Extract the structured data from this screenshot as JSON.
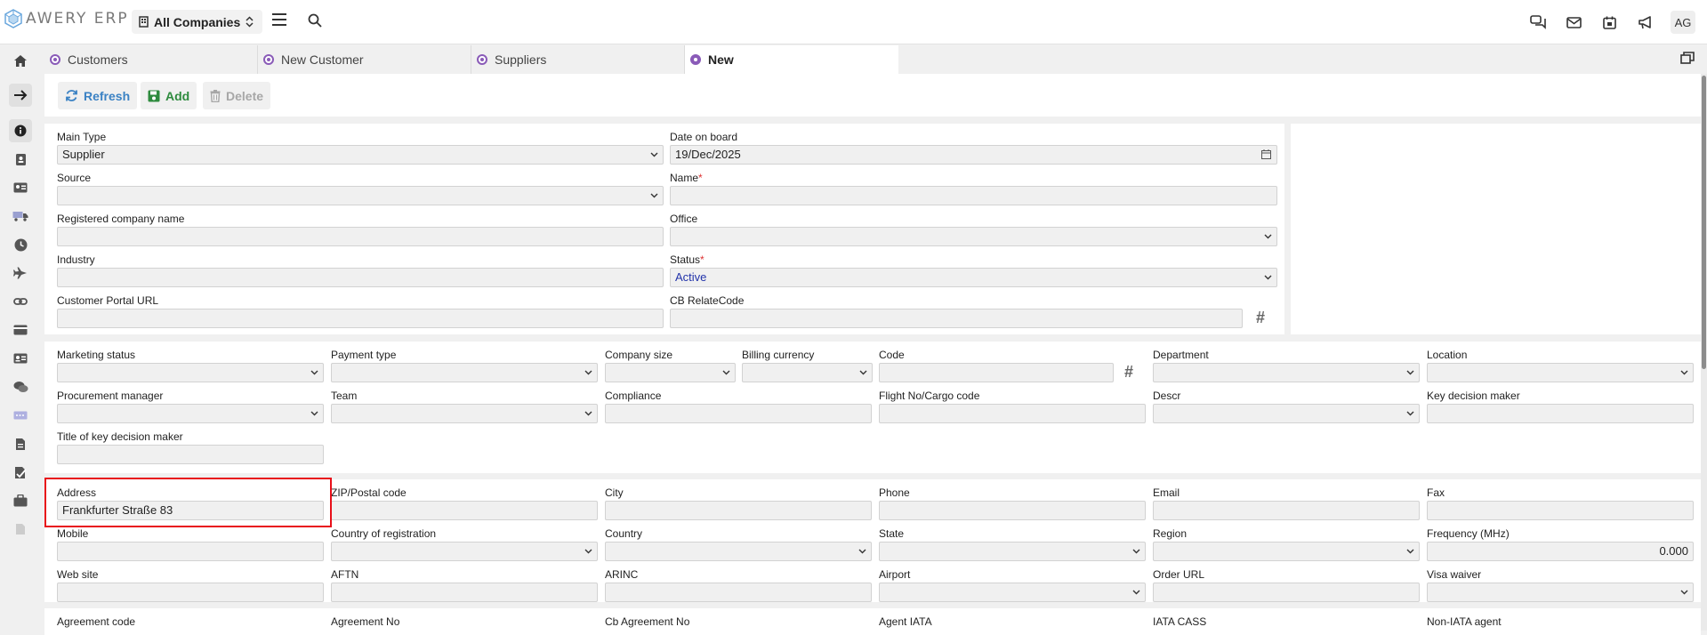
{
  "app": {
    "logo_text": "AWERY ERP",
    "company_select": "All Companies",
    "user_initials": "AG"
  },
  "top_icons": [
    "chat-icon",
    "mail-icon",
    "calendar-icon",
    "megaphone-icon"
  ],
  "tabs": [
    {
      "label": "Customers",
      "active": false
    },
    {
      "label": "New Customer",
      "active": false
    },
    {
      "label": "Suppliers",
      "active": false
    },
    {
      "label": "New",
      "active": true
    }
  ],
  "toolbar": {
    "refresh_label": "Refresh",
    "add_label": "Add",
    "delete_label": "Delete"
  },
  "section1": {
    "main_type": {
      "label": "Main Type",
      "value": "Supplier"
    },
    "source": {
      "label": "Source",
      "value": ""
    },
    "registered_company_name": {
      "label": "Registered company name",
      "value": ""
    },
    "industry": {
      "label": "Industry",
      "value": ""
    },
    "customer_portal_url": {
      "label": "Customer Portal URL",
      "value": ""
    },
    "date_on_board": {
      "label": "Date on board",
      "value": "19/Dec/2025"
    },
    "name": {
      "label": "Name",
      "value": ""
    },
    "office": {
      "label": "Office",
      "value": ""
    },
    "status": {
      "label": "Status",
      "value": "Active"
    },
    "cb_relatecode": {
      "label": "CB RelateCode",
      "value": ""
    },
    "required_mark": "*"
  },
  "section2": {
    "marketing_status": "Marketing status",
    "payment_type": "Payment type",
    "company_size": "Company size",
    "billing_currency": "Billing currency",
    "code": "Code",
    "department": "Department",
    "location": "Location",
    "procurement_manager": "Procurement manager",
    "team": "Team",
    "compliance": "Compliance",
    "flight_no": "Flight No/Cargo code",
    "descr": "Descr",
    "key_decision_maker": "Key decision maker",
    "title_key_decision_maker": "Title of key decision maker"
  },
  "section3": {
    "address": {
      "label": "Address",
      "value": "Frankfurter Straße 83"
    },
    "zip": "ZIP/Postal code",
    "city": "City",
    "phone": "Phone",
    "email": "Email",
    "fax": "Fax",
    "mobile": "Mobile",
    "country_of_registration": "Country of registration",
    "country": "Country",
    "state": "State",
    "region": "Region",
    "frequency": {
      "label": "Frequency (MHz)",
      "value": "0.000"
    },
    "website": "Web site",
    "aftn": "AFTN",
    "arinc": "ARINC",
    "airport": "Airport",
    "order_url": "Order URL",
    "visa_waiver": "Visa waiver"
  },
  "section4": {
    "agreement_code": "Agreement code",
    "agreement_no": "Agreement No",
    "cb_agreement_no": "Cb Agreement No",
    "agent_iata": "Agent IATA",
    "iata_cass": "IATA CASS",
    "non_iata_agent": "Non-IATA agent"
  },
  "hash_symbol": "#"
}
